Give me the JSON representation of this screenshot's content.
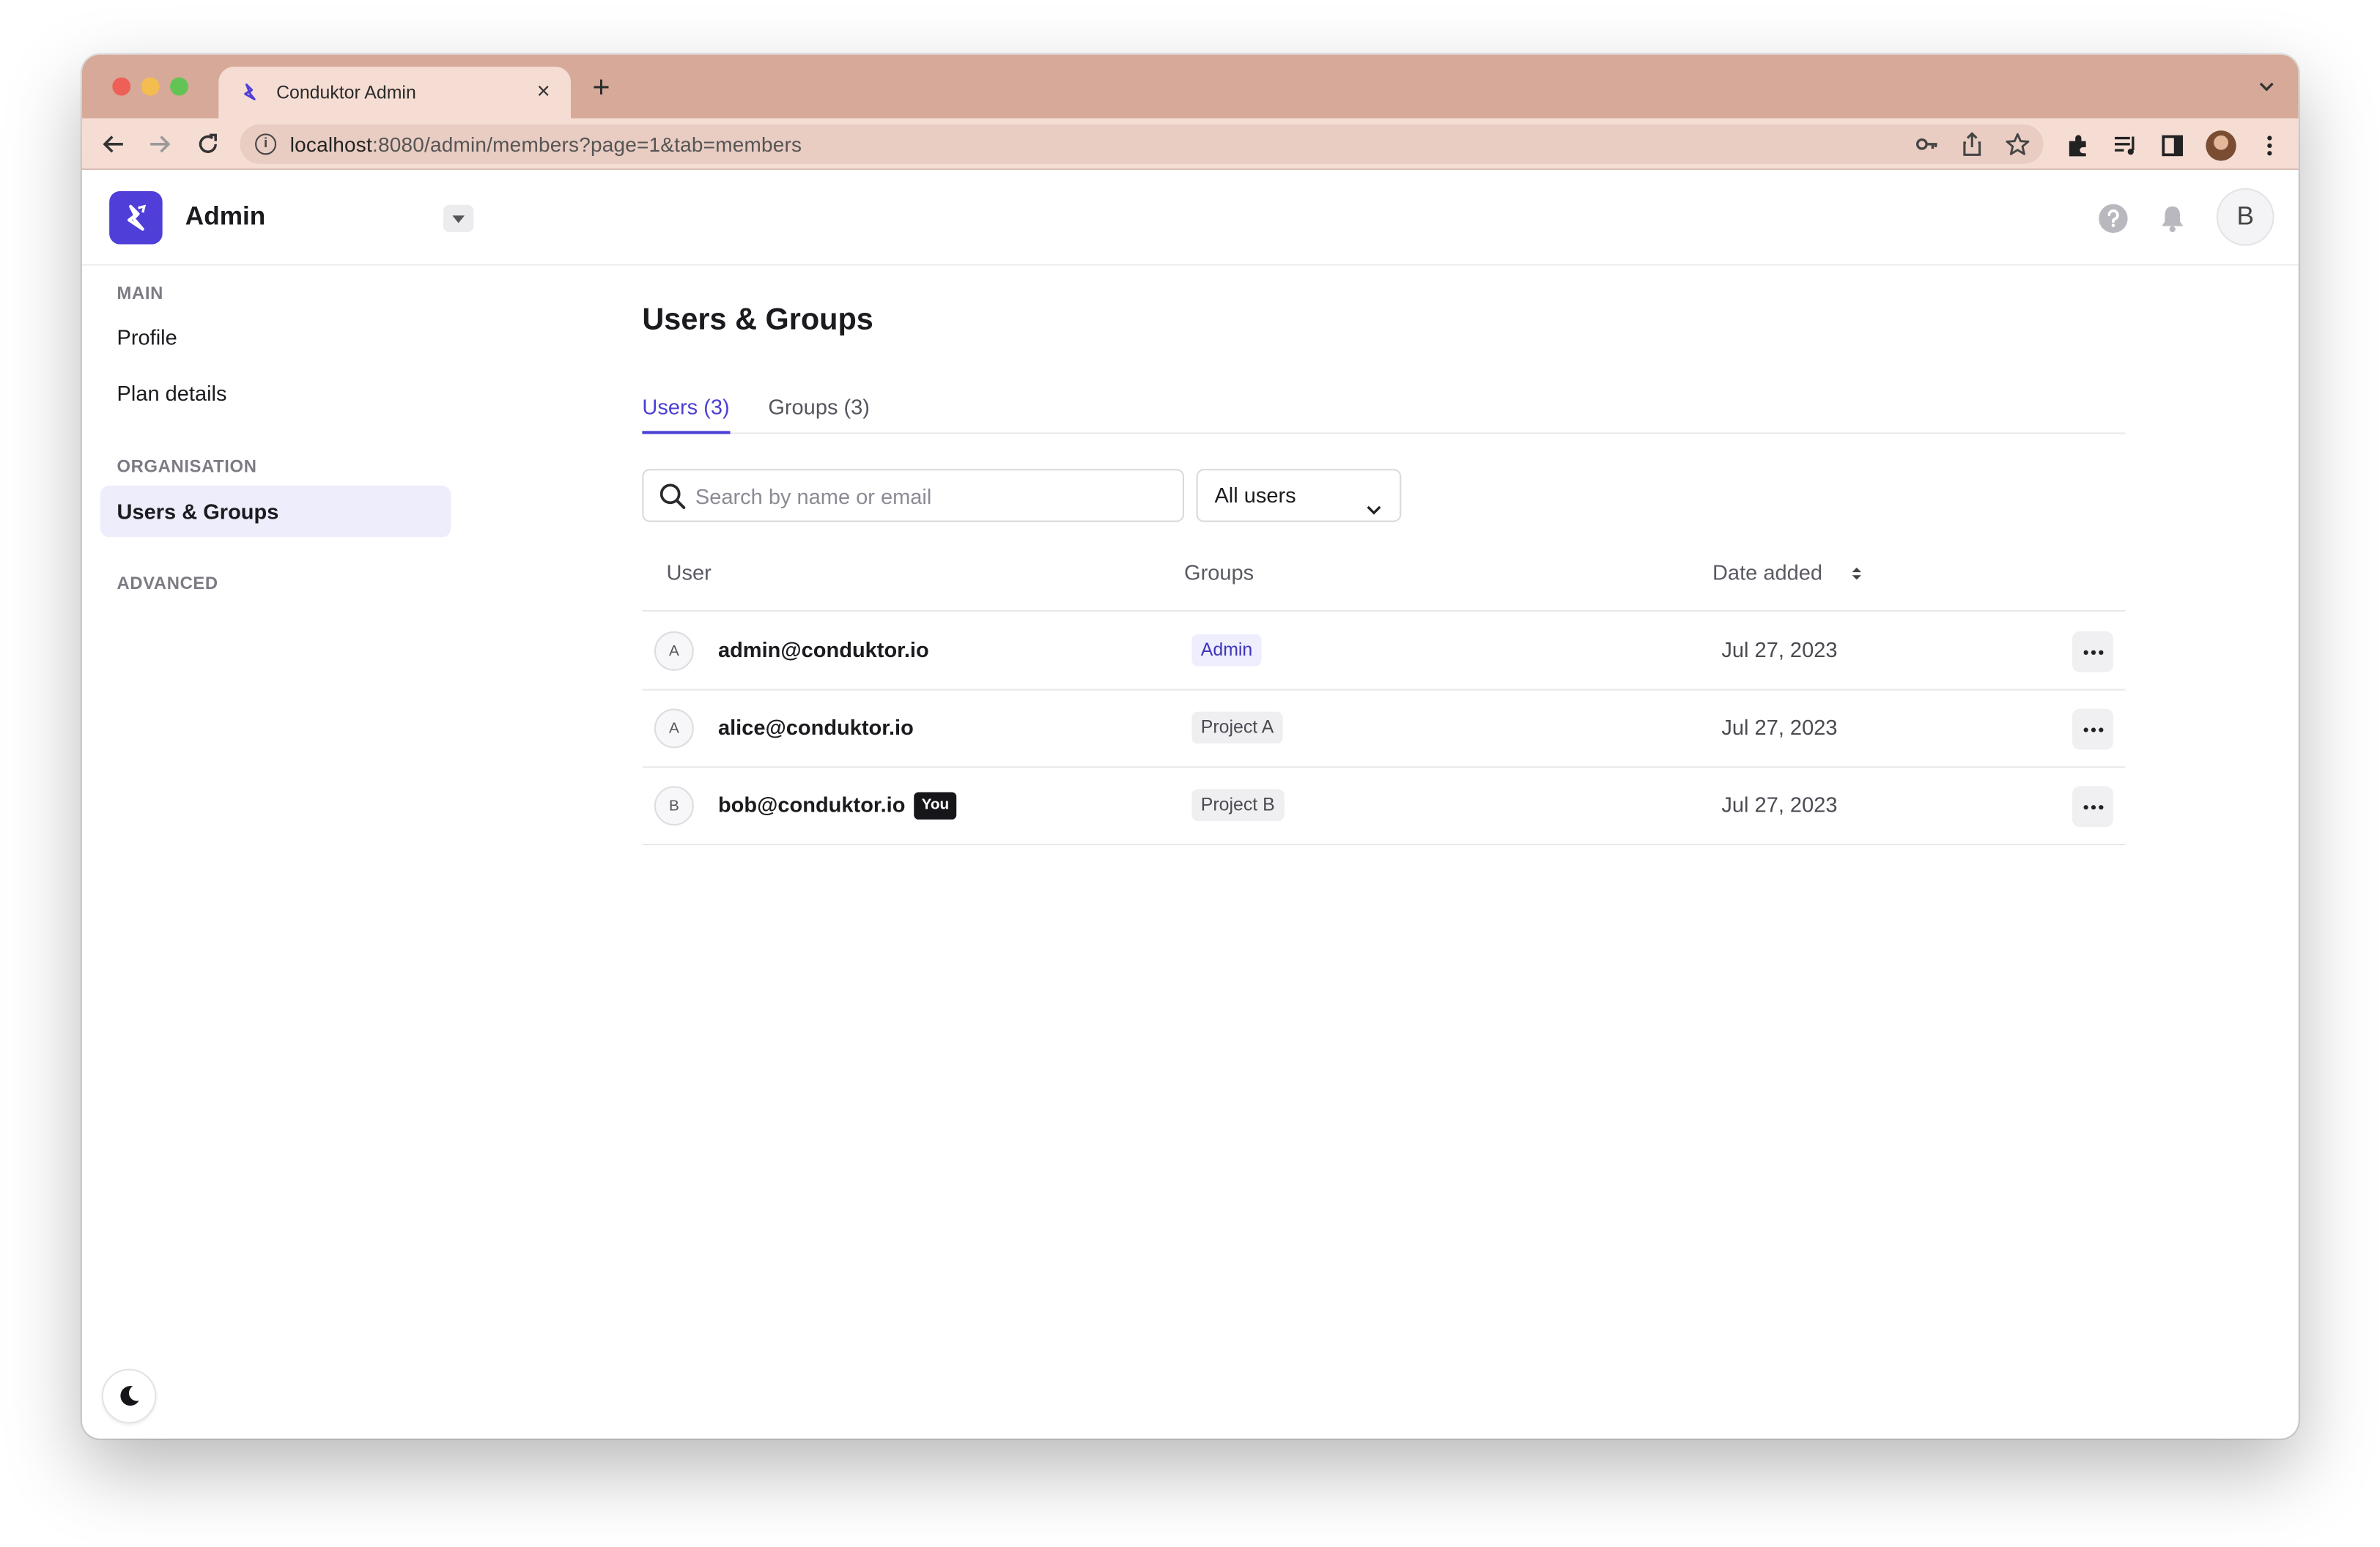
{
  "browser": {
    "tab_title": "Conduktor Admin",
    "tab_close": "×",
    "new_tab": "+",
    "url_host": "localhost",
    "url_rest": ":8080/admin/members?page=1&tab=members",
    "info_icon": "i"
  },
  "header": {
    "app_name": "Admin",
    "user_initial": "B"
  },
  "sidebar": {
    "sections": {
      "main": "MAIN",
      "organisation": "ORGANISATION",
      "advanced": "ADVANCED"
    },
    "items": [
      {
        "label": "Profile"
      },
      {
        "label": "Plan details"
      },
      {
        "label": "Users & Groups",
        "active": true
      }
    ]
  },
  "main": {
    "title": "Users & Groups",
    "tabs": [
      {
        "label": "Users (3)",
        "active": true
      },
      {
        "label": "Groups (3)",
        "active": false
      }
    ],
    "search": {
      "placeholder": "Search by name or email",
      "value": ""
    },
    "filter": {
      "selected": "All users"
    },
    "table": {
      "columns": [
        "User",
        "Groups",
        "Date added"
      ],
      "rows": [
        {
          "initial": "A",
          "email": "admin@conduktor.io",
          "badge": "",
          "group": "Admin",
          "date": "Jul 27, 2023"
        },
        {
          "initial": "A",
          "email": "alice@conduktor.io",
          "badge": "",
          "group": "Project A",
          "date": "Jul 27, 2023"
        },
        {
          "initial": "B",
          "email": "bob@conduktor.io",
          "badge": "You",
          "group": "Project B",
          "date": "Jul 27, 2023"
        }
      ]
    }
  },
  "colors": {
    "accent": "#4b3fd6",
    "tabstrip": "#d7a999",
    "toolbar": "#f6ddd4",
    "active_nav_bg": "#ededfb"
  },
  "icons": {
    "search": "search-icon",
    "sort": "sort-icon",
    "more": "more-horizontal-icon",
    "theme": "moon-icon",
    "help": "help-icon",
    "bell": "bell-icon"
  }
}
